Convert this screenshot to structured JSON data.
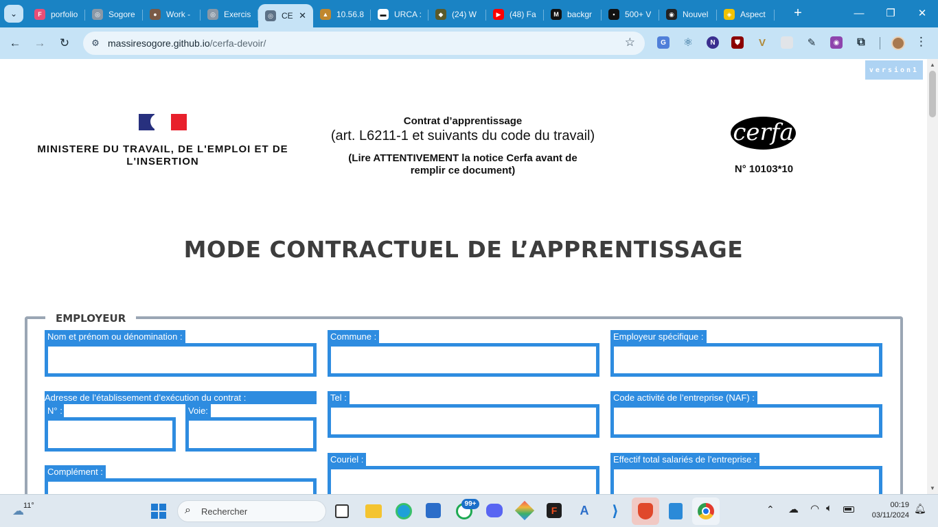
{
  "browser": {
    "tabs": [
      {
        "title": "porfolio",
        "fav_color": "#e94e77",
        "fav_glyph": "F"
      },
      {
        "title": "Sogore",
        "fav_color": "#8a98a6",
        "fav_glyph": "◎"
      },
      {
        "title": "Work -",
        "fav_color": "#7a5a46",
        "fav_glyph": "●"
      },
      {
        "title": "Exercis",
        "fav_color": "#8a98a6",
        "fav_glyph": "◎"
      },
      {
        "title": "CE",
        "fav_color": "#5c7186",
        "fav_glyph": "◎",
        "active": true
      },
      {
        "title": "10.56.8",
        "fav_color": "#c0872e",
        "fav_glyph": "▲"
      },
      {
        "title": "URCA :",
        "fav_color": "#ffffff",
        "fav_glyph": "▬"
      },
      {
        "title": "(24) W",
        "fav_color": "#5a5a2a",
        "fav_glyph": "◆"
      },
      {
        "title": "(48) Fa",
        "fav_color": "#ff0000",
        "fav_glyph": "▶"
      },
      {
        "title": "backgr",
        "fav_color": "#111111",
        "fav_glyph": "M"
      },
      {
        "title": "500+ V",
        "fav_color": "#111111",
        "fav_glyph": "▪"
      },
      {
        "title": "Nouvel",
        "fav_color": "#222222",
        "fav_glyph": "◉"
      },
      {
        "title": "Aspect",
        "fav_color": "#f2c200",
        "fav_glyph": "◈"
      }
    ],
    "address": {
      "host": "massiresogore.github.io",
      "path": "/cerfa-devoir/"
    }
  },
  "page": {
    "version_badge": "version1",
    "ministry": "MINISTERE DU TRAVAIL, DE L'EMPLOI ET DE L'INSERTION",
    "contract_title": "Contrat d’apprentissage",
    "contract_subtitle": "(art. L6211-1 et suivants du code du travail)",
    "notice": "(Lire ATTENTIVEMENT la notice Cerfa avant de remplir ce document)",
    "cerfa_logo": "cerfa",
    "cerfa_number": "N° 10103*10",
    "heading": "MODE CONTRACTUEL DE L’APPRENTISSAGE",
    "section_title": "EMPLOYEUR",
    "fields": {
      "nom": "Nom et prénom ou dénomination :",
      "commune": "Commune :",
      "employeur_specifique": "Employeur spécifique :",
      "adresse": "Adresse de l’établissement d’exécution du contrat :",
      "numero": "N° :",
      "voie": "Voie:",
      "tel": "Tel :",
      "naf": "Code activité de l’entreprise (NAF) :",
      "complement": "Complément :",
      "courriel": "Couriel :",
      "effectif": "Effectif total salariés de l’entreprise :"
    }
  },
  "taskbar": {
    "weather": "11°",
    "search_placeholder": "Rechercher",
    "whatsapp_badge": "99+",
    "time": "00:19",
    "date": "03/11/2024"
  }
}
